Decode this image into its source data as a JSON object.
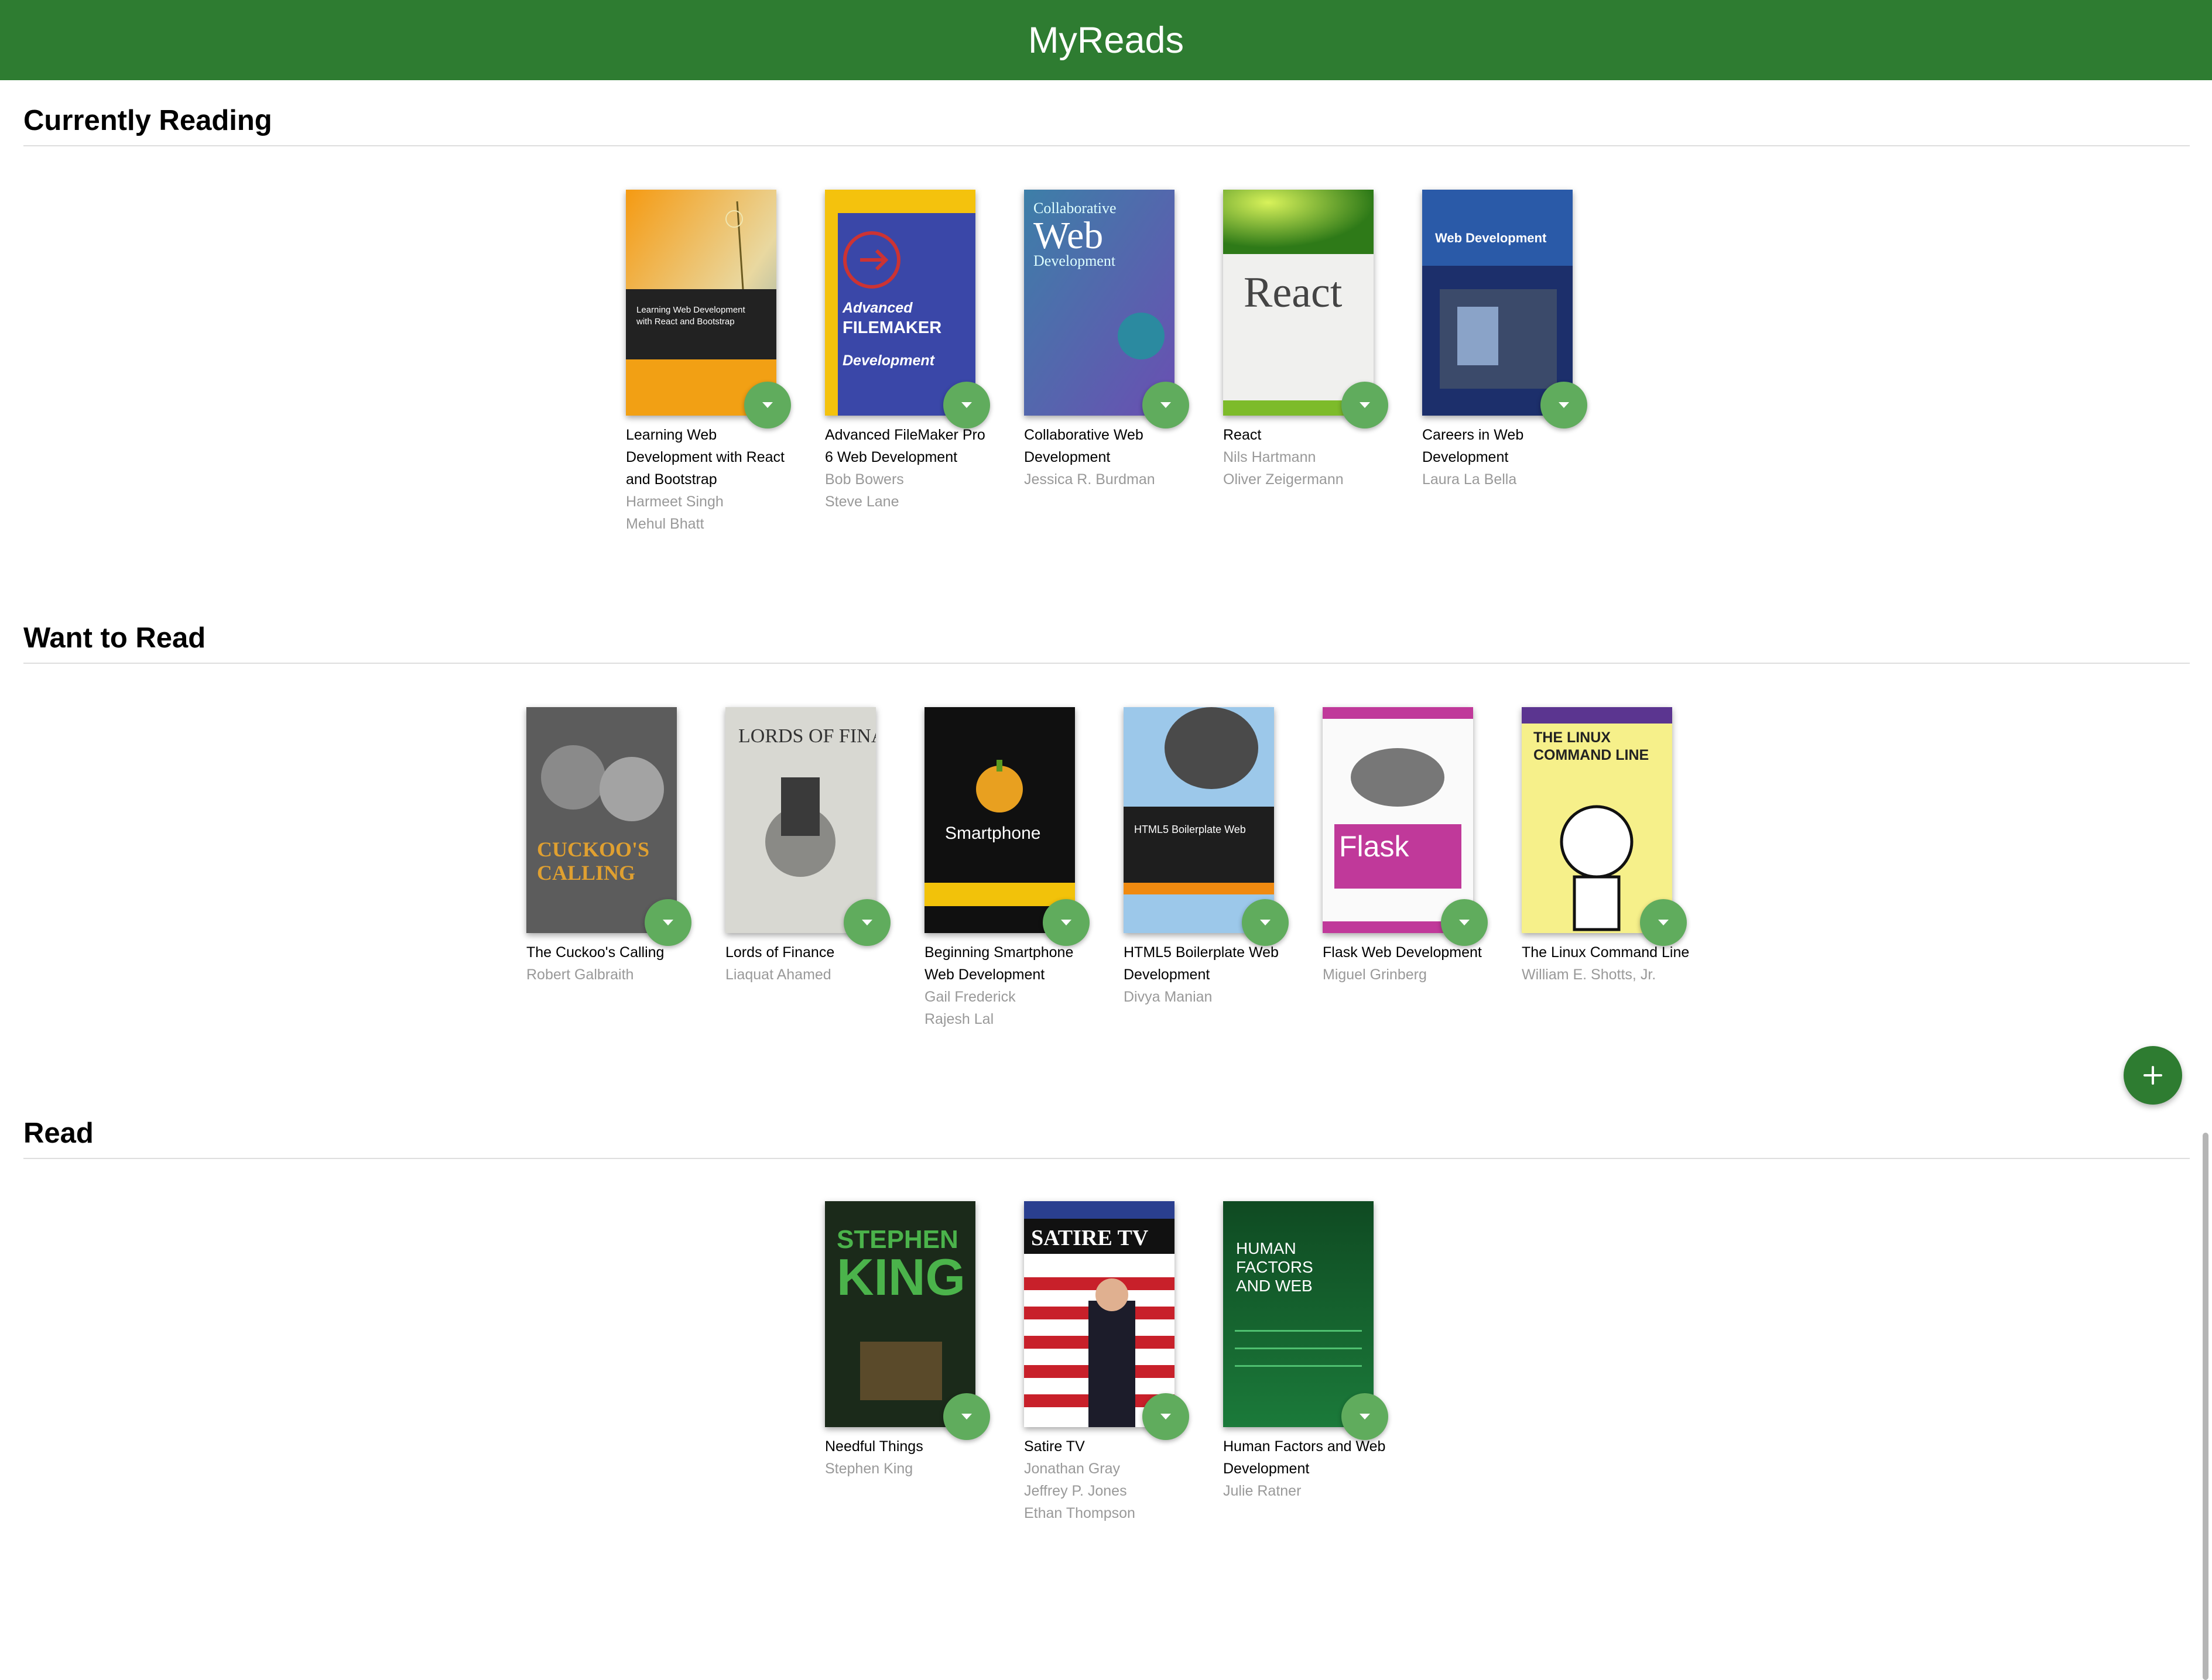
{
  "app": {
    "title": "MyReads"
  },
  "shelves": [
    {
      "title": "Currently Reading",
      "books": [
        {
          "title": "Learning Web Development with React and Bootstrap",
          "authors": [
            "Harmeet Singh",
            "Mehul Bhatt"
          ],
          "cover_text": "Learning Web Development with React and Bootstrap",
          "cover_icon": "orange-plant-cover"
        },
        {
          "title": "Advanced FileMaker Pro 6 Web Development",
          "authors": [
            "Bob Bowers",
            "Steve Lane"
          ],
          "cover_text": "Advanced FileMaker Pro 6 Web Development",
          "cover_icon": "blue-arrow-cover"
        },
        {
          "title": "Collaborative Web Development",
          "authors": [
            "Jessica R. Burdman"
          ],
          "cover_text": "Collaborative Web Development",
          "cover_icon": "blue-purple-cover"
        },
        {
          "title": "React",
          "authors": [
            "Nils Hartmann",
            "Oliver Zeigermann"
          ],
          "cover_text": "React",
          "cover_icon": "green-white-cover"
        },
        {
          "title": "Careers in Web Development",
          "authors": [
            "Laura La Bella"
          ],
          "cover_text": "Careers in Web Development",
          "cover_icon": "dark-blue-cover"
        }
      ]
    },
    {
      "title": "Want to Read",
      "books": [
        {
          "title": "The Cuckoo's Calling",
          "authors": [
            "Robert Galbraith"
          ],
          "cover_text": "THE CUCKOO'S CALLING",
          "cover_icon": "grey-portrait-cover"
        },
        {
          "title": "Lords of Finance",
          "authors": [
            "Liaquat Ahamed"
          ],
          "cover_text": "LORDS OF FINANCE",
          "cover_icon": "globe-men-cover"
        },
        {
          "title": "Beginning Smartphone Web Development",
          "authors": [
            "Gail Frederick",
            "Rajesh Lal"
          ],
          "cover_text": "Beginning Smartphone Web Development",
          "cover_icon": "black-yellow-cover"
        },
        {
          "title": "HTML5 Boilerplate Web Development",
          "authors": [
            "Divya Manian"
          ],
          "cover_text": "HTML5 Boilerplate Web Development",
          "cover_icon": "leaf-sky-cover"
        },
        {
          "title": "Flask Web Development",
          "authors": [
            "Miguel Grinberg"
          ],
          "cover_text": "Flask Web Development",
          "cover_icon": "oreilly-dog-cover"
        },
        {
          "title": "The Linux Command Line",
          "authors": [
            "William E. Shotts, Jr."
          ],
          "cover_text": "THE LINUX COMMAND LINE",
          "cover_icon": "yellow-comic-cover"
        }
      ]
    },
    {
      "title": "Read",
      "books": [
        {
          "title": "Needful Things",
          "authors": [
            "Stephen King"
          ],
          "cover_text": "STEPHEN KING",
          "cover_icon": "dark-green-sign-cover"
        },
        {
          "title": "Satire TV",
          "authors": [
            "Jonathan Gray",
            "Jeffrey P. Jones",
            "Ethan Thompson"
          ],
          "cover_text": "SATIRE TV",
          "cover_icon": "flag-man-cover"
        },
        {
          "title": "Human Factors and Web Development",
          "authors": [
            "Julie Ratner"
          ],
          "cover_text": "HUMAN FACTORS AND WEB DEVELOPMENT",
          "cover_icon": "green-code-cover"
        }
      ]
    }
  ],
  "colors": {
    "header": "#2e7c31",
    "shelf_changer": "#60ac5d",
    "add_button": "#2e7c31",
    "author_text": "#999999"
  },
  "icons": {
    "shelf_changer": "triangle-down-icon",
    "add": "plus-icon"
  }
}
